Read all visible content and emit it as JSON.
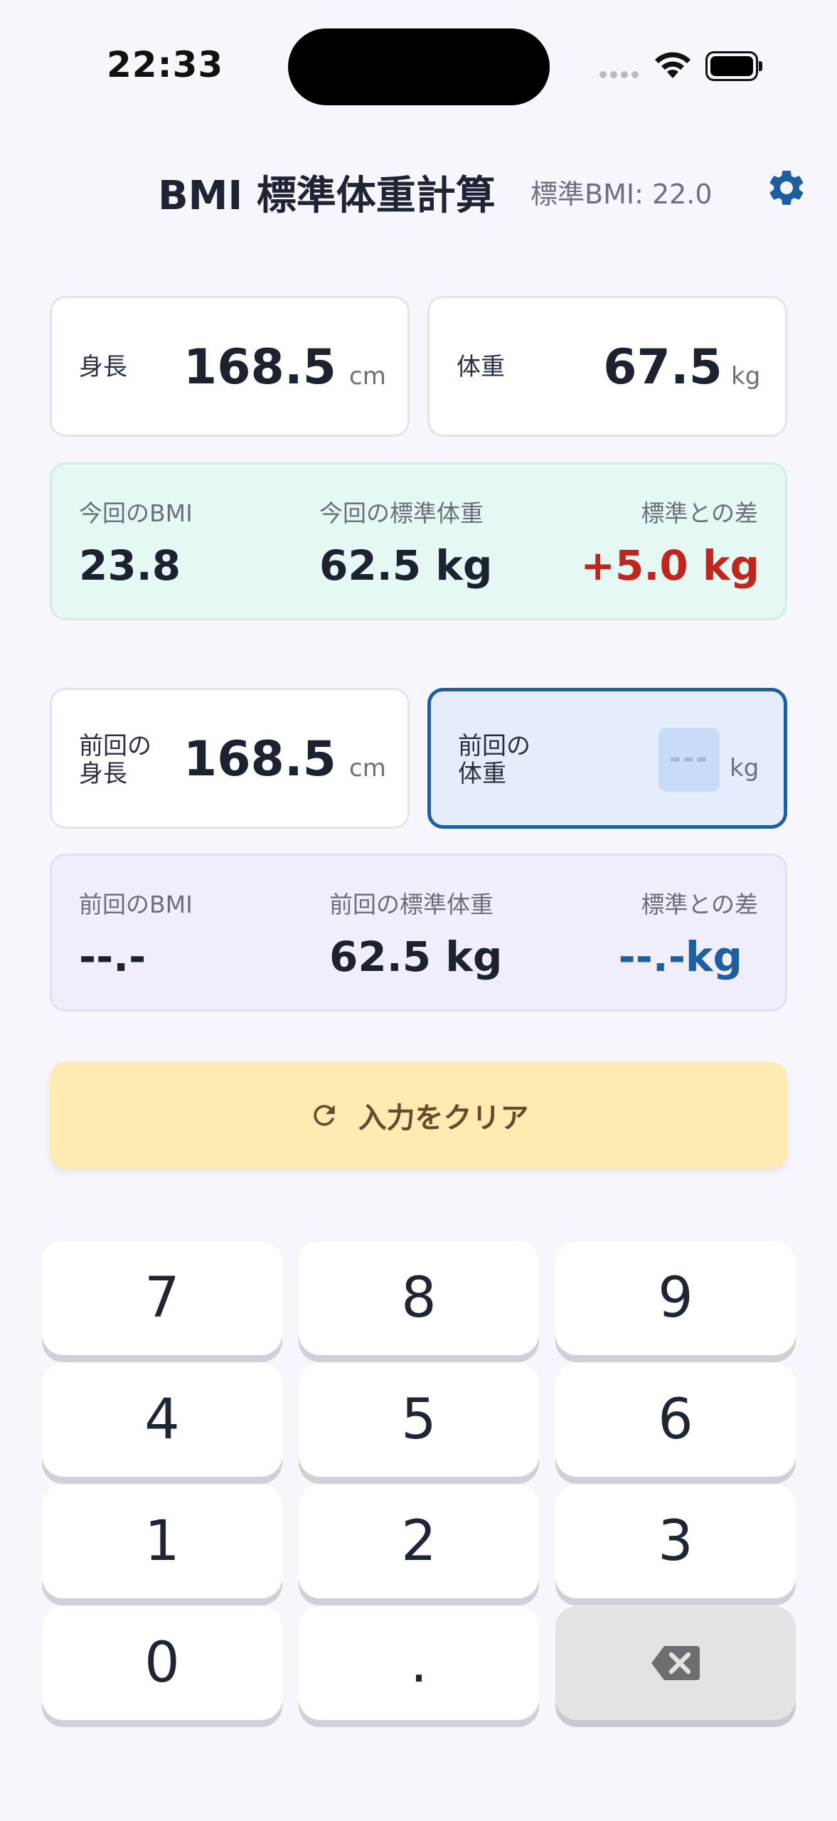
{
  "status_bar": {
    "time": "22:33"
  },
  "header": {
    "title": "BMI 標準体重計算",
    "standard_bmi": "標準BMI: 22.0",
    "settings_icon": "gear-icon",
    "accent_color": "#1d5fa0"
  },
  "current": {
    "height": {
      "label": "身長",
      "value": "168.5",
      "unit": "cm"
    },
    "weight": {
      "label": "体重",
      "value": "67.5",
      "unit": "kg"
    },
    "results": {
      "bmi_label": "今回のBMI",
      "bmi_value": "23.8",
      "std_weight_label": "今回の標準体重",
      "std_weight_value": "62.5 kg",
      "diff_label": "標準との差",
      "diff_value": "+5.0 kg",
      "diff_color": "#c0261d"
    }
  },
  "previous": {
    "height": {
      "label_line1": "前回の",
      "label_line2": "身長",
      "value": "168.5",
      "unit": "cm"
    },
    "weight": {
      "label_line1": "前回の",
      "label_line2": "体重",
      "placeholder": "---",
      "unit": "kg"
    },
    "results": {
      "bmi_label": "前回のBMI",
      "bmi_value": "--.-",
      "std_weight_label": "前回の標準体重",
      "std_weight_value": "62.5 kg",
      "diff_label": "標準との差",
      "diff_value": "--.-kg",
      "diff_color": "#1d5fa0"
    }
  },
  "clear_button": {
    "label": "入力をクリア",
    "icon": "refresh-icon"
  },
  "keypad": {
    "keys": [
      "7",
      "8",
      "9",
      "4",
      "5",
      "6",
      "1",
      "2",
      "3",
      "0",
      "."
    ],
    "delete_icon": "backspace-icon"
  }
}
